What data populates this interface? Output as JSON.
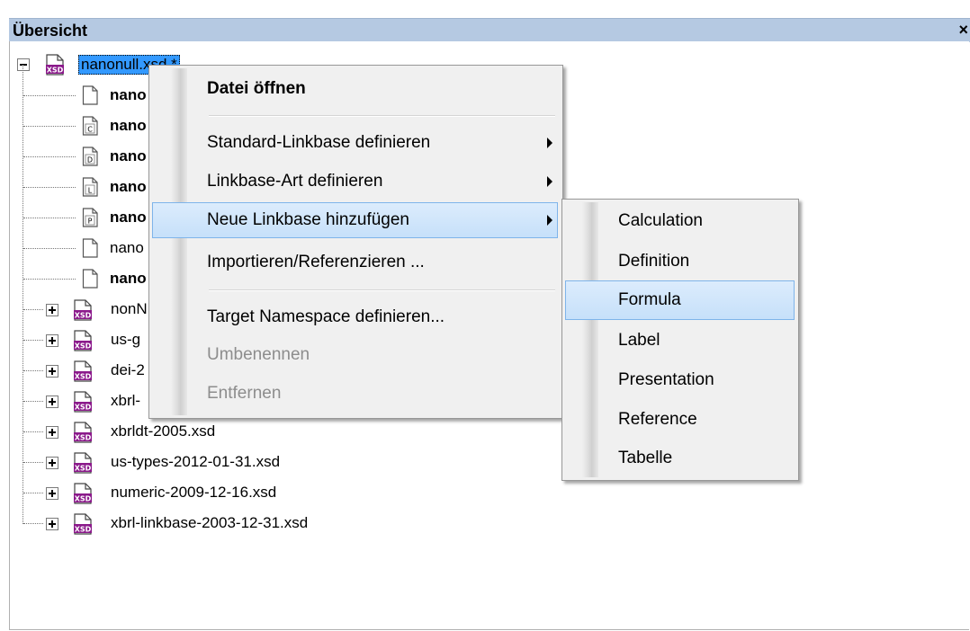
{
  "panel": {
    "title": "Übersicht",
    "close_label": "×"
  },
  "tree": {
    "root": {
      "label": "nanonull.xsd *",
      "state": "expanded",
      "icon": "xsd-file-icon"
    },
    "children": [
      {
        "label": "nano",
        "icon": "blank-doc-icon",
        "letter": "",
        "bold": true
      },
      {
        "label": "nano",
        "icon": "calc-doc-icon",
        "letter": "C",
        "bold": true
      },
      {
        "label": "nano",
        "icon": "def-doc-icon",
        "letter": "D",
        "bold": true
      },
      {
        "label": "nano",
        "icon": "label-doc-icon",
        "letter": "L",
        "bold": true
      },
      {
        "label": "nano",
        "icon": "pres-doc-icon",
        "letter": "P",
        "bold": true
      },
      {
        "label": "nano",
        "icon": "blank-doc-icon",
        "letter": "",
        "bold": false
      },
      {
        "label": "nano",
        "icon": "blank-doc-icon",
        "letter": "",
        "bold": true
      }
    ],
    "siblings": [
      {
        "label": "nonN"
      },
      {
        "label": "us-g"
      },
      {
        "label": "dei-2"
      },
      {
        "label": "xbrl-"
      },
      {
        "label": "xbrldt-2005.xsd"
      },
      {
        "label": "us-types-2012-01-31.xsd"
      },
      {
        "label": "numeric-2009-12-16.xsd"
      },
      {
        "label": "xbrl-linkbase-2003-12-31.xsd"
      }
    ]
  },
  "context_menu": {
    "items": [
      {
        "label": "Datei öffnen",
        "bold": true
      },
      {
        "label": "Standard-Linkbase definieren",
        "submenu": true
      },
      {
        "label": "Linkbase-Art definieren",
        "submenu": true
      },
      {
        "label": "Neue Linkbase hinzufügen",
        "submenu": true,
        "highlighted": true
      },
      {
        "label": "Importieren/Referenzieren ..."
      },
      {
        "label": "Target Namespace definieren..."
      },
      {
        "label": "Umbenennen",
        "disabled": true
      },
      {
        "label": "Entfernen",
        "disabled": true
      }
    ]
  },
  "submenu": {
    "items": [
      {
        "label": "Calculation"
      },
      {
        "label": "Definition"
      },
      {
        "label": "Formula",
        "highlighted": true
      },
      {
        "label": "Label"
      },
      {
        "label": "Presentation"
      },
      {
        "label": "Reference"
      },
      {
        "label": "Tabelle"
      }
    ]
  },
  "colors": {
    "titlebar": "#b5c9e2",
    "selection": "#3399ff",
    "menu_bg": "#f0f0f0",
    "menu_hover": "#c6e0fa",
    "xsd_badge": "#8b1a8b"
  }
}
